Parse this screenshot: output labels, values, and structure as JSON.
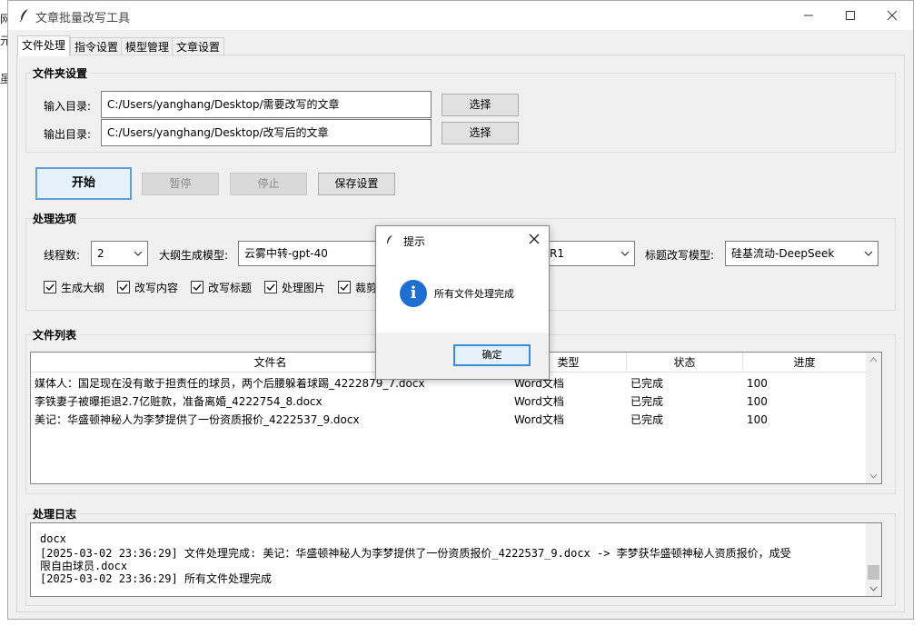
{
  "desktop": {
    "fragments": [
      "网",
      "元",
      "虽"
    ]
  },
  "window": {
    "title": "文章批量改写工具",
    "controls": [
      "minimize",
      "maximize",
      "close"
    ]
  },
  "tabs": [
    "文件处理",
    "指令设置",
    "模型管理",
    "文章设置"
  ],
  "folder": {
    "title": "文件夹设置",
    "input_label": "输入目录:",
    "input_value": "C:/Users/yanghang/Desktop/需要改写的文章",
    "output_label": "输出目录:",
    "output_value": "C:/Users/yanghang/Desktop/改写后的文章",
    "select_label": "选择"
  },
  "actions": {
    "start": "开始",
    "pause": "暂停",
    "stop": "停止",
    "save": "保存设置"
  },
  "options": {
    "title": "处理选项",
    "threads_label": "线程数:",
    "threads_value": "2",
    "outline_model_label": "大纲生成模型:",
    "outline_model_value": "云雾中转-gpt-40",
    "hidden_model_tail": "R1",
    "title_model_label": "标题改写模型:",
    "title_model_value": "硅基流动-DeepSeek",
    "checks": [
      "生成大纲",
      "改写内容",
      "改写标题",
      "处理图片",
      "裁剪"
    ]
  },
  "files": {
    "title": "文件列表",
    "columns": [
      "文件名",
      "类型",
      "状态",
      "进度"
    ],
    "rows": [
      {
        "name": "媒体人：国足现在没有敢于担责任的球员，两个后腰躲着球踢_4222879_7.docx",
        "type": "Word文档",
        "status": "已完成",
        "progress": "100"
      },
      {
        "name": "李铁妻子被曝拒退2.7亿赃款，准备离婚_4222754_8.docx",
        "type": "Word文档",
        "status": "已完成",
        "progress": "100"
      },
      {
        "name": "美记：华盛顿神秘人为李梦提供了一份资质报价_4222537_9.docx",
        "type": "Word文档",
        "status": "已完成",
        "progress": "100"
      }
    ]
  },
  "log": {
    "title": "处理日志",
    "lines": [
      "[2025-03-02 23:36:29] 文件处理完成: 美记：华盛顿神秘人为李梦提供了一份资质报价_4222537_9.docx -> 李梦获华盛顿神秘人资质报价，成受",
      "限自由球员.docx",
      "[2025-03-02 23:36:29] 所有文件处理完成"
    ],
    "clipped_line_tail": "docx"
  },
  "dialog": {
    "title": "提示",
    "message": "所有文件处理完成",
    "ok": "确定",
    "icon": "info-icon",
    "accent": "#1f6fd1"
  }
}
